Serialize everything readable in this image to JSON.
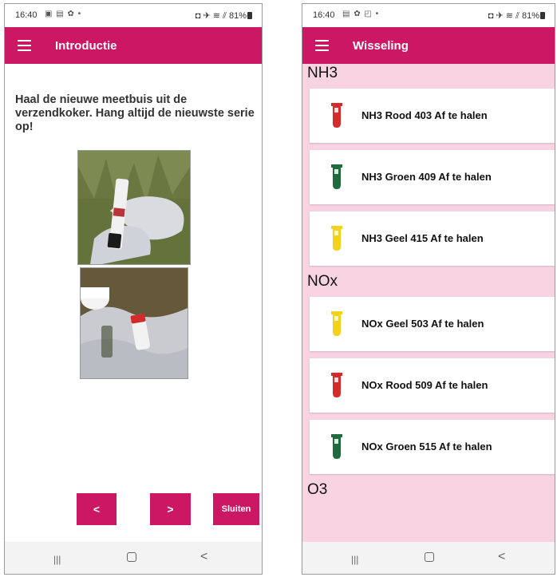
{
  "status_bar": {
    "time": "16:40",
    "battery": "81%"
  },
  "intro_screen": {
    "title": "Introductie",
    "instruction": "Haal de nieuwe meetbuis uit de verzendkoker. Hang altijd de nieuwste serie op!",
    "prev_label": "<",
    "next_label": ">",
    "close_label": "Sluiten"
  },
  "exchange_screen": {
    "title": "Wisseling",
    "sections": [
      {
        "name": "NH3",
        "items": [
          {
            "label": "NH3 Rood 403 Af te halen",
            "color": "#d62b2b",
            "icon": "red-tube-icon"
          },
          {
            "label": "NH3 Groen 409 Af te halen",
            "color": "#1f6b3d",
            "icon": "green-tube-icon"
          },
          {
            "label": "NH3 Geel 415 Af te halen",
            "color": "#f2d21b",
            "icon": "yellow-tube-icon"
          }
        ]
      },
      {
        "name": "NOx",
        "items": [
          {
            "label": "NOx Geel 503 Af te halen",
            "color": "#f2d21b",
            "icon": "yellow-tube-icon"
          },
          {
            "label": "NOx Rood 509 Af te halen",
            "color": "#d62b2b",
            "icon": "red-tube-icon"
          },
          {
            "label": "NOx Groen 515 Af te halen",
            "color": "#1f6b3d",
            "icon": "green-tube-icon"
          }
        ]
      },
      {
        "name": "O3",
        "items": []
      }
    ]
  },
  "navbar": {
    "recent": "|||",
    "back": "<"
  },
  "colors": {
    "accent": "#cc1765",
    "list_background": "#f8d4e3"
  }
}
